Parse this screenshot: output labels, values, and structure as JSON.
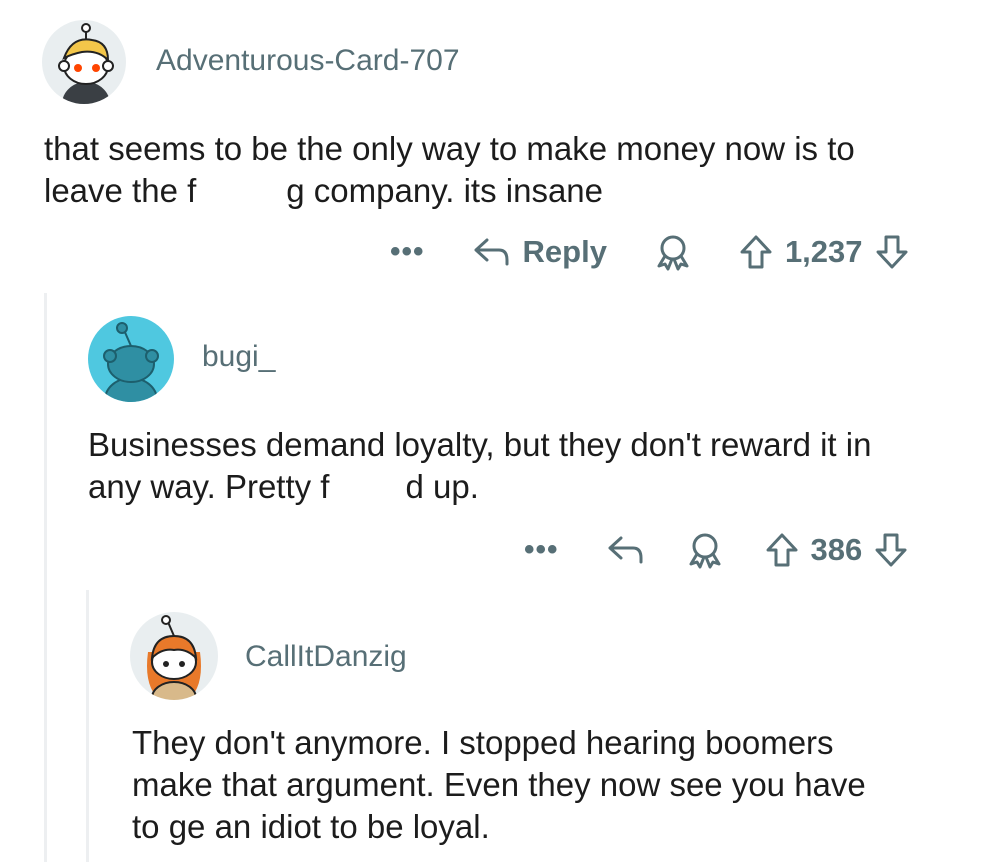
{
  "comments": [
    {
      "username": "Adventurous-Card-707",
      "lines": [
        "that seems to be the only way to make money now is to",
        "leave the f",
        "g company. its insane"
      ],
      "more": "•••",
      "reply_label": "Reply",
      "votes": "1,237",
      "avatar_icon": "snoo-avatar-blonde-icon"
    },
    {
      "username": "bugi_",
      "lines": [
        "Businesses demand loyalty, but they don't reward it in",
        "any way. Pretty f",
        "d up."
      ],
      "more": "•••",
      "votes": "386",
      "avatar_icon": "snoo-avatar-default-teal-icon"
    },
    {
      "username": "CallItDanzig",
      "lines": [
        "They don't anymore. I stopped hearing boomers",
        "make that argument. Even they now see you have",
        "to ge an idiot to be loyal."
      ],
      "avatar_icon": "snoo-avatar-redhead-icon"
    }
  ],
  "colors": {
    "meta": "#576f76",
    "text": "#1c1c1c",
    "thread_line": "#edeff1",
    "teal": "#4fc8e0"
  }
}
